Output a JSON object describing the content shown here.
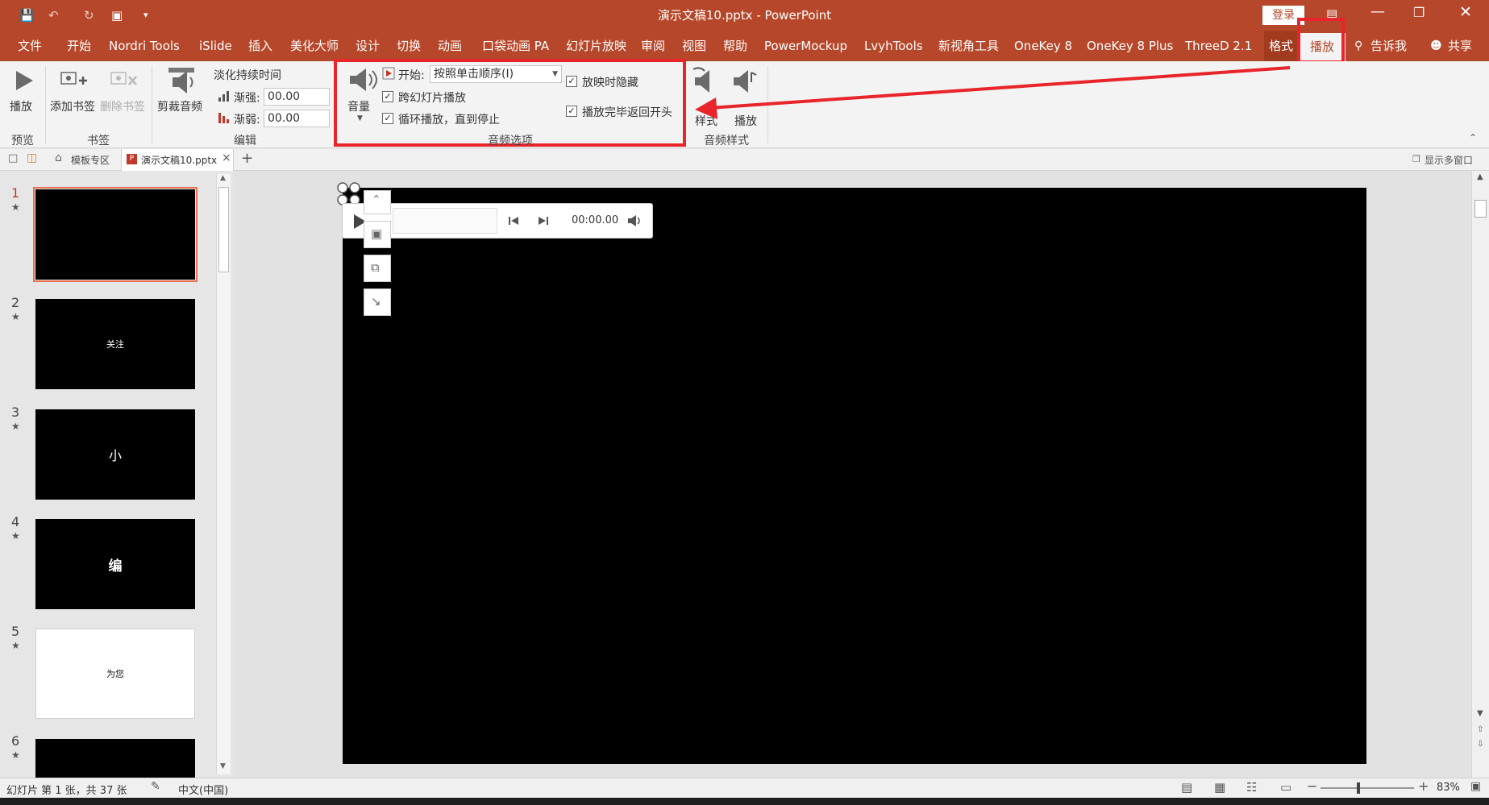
{
  "window": {
    "title": "演示文稿10.pptx  -  PowerPoint",
    "login_label": "登录"
  },
  "menu": {
    "tabs": [
      "文件",
      "开始",
      "Nordri Tools",
      "iSlide",
      "插入",
      "美化大师",
      "设计",
      "切换",
      "动画",
      "口袋动画 PA",
      "幻灯片放映",
      "审阅",
      "视图",
      "帮助",
      "PowerMockup",
      "LvyhTools",
      "新视角工具",
      "OneKey 8",
      "OneKey 8 Plus",
      "ThreeD 2.1",
      "格式",
      "播放"
    ],
    "active_tab": "播放",
    "tell_me": "告诉我",
    "share": "共享"
  },
  "ribbon": {
    "preview": {
      "play_label": "播放",
      "group": "预览"
    },
    "bookmarks": {
      "add_label": "添加书签",
      "remove_label": "删除书签",
      "group": "书签"
    },
    "editing": {
      "trim_label": "剪裁音频",
      "fade_title": "淡化持续时间",
      "fade_in_label": "渐强:",
      "fade_in_value": "00.00",
      "fade_out_label": "渐弱:",
      "fade_out_value": "00.00",
      "group": "编辑"
    },
    "audio_options": {
      "volume_label": "音量",
      "start_label": "开始:",
      "start_value": "按照单击顺序(I)",
      "across_slides": "跨幻灯片播放",
      "loop": "循环播放，直到停止",
      "hide_during_show": "放映时隐藏",
      "rewind": "播放完毕返回开头",
      "group": "音频选项"
    },
    "audio_styles": {
      "style_label": "样式",
      "play_label": "播放",
      "group": "音频样式"
    }
  },
  "doc_tabs": {
    "template": "模板专区",
    "file": "演示文稿10.pptx",
    "multi_window": "显示多窗口"
  },
  "slides": [
    {
      "num": "1",
      "text": ""
    },
    {
      "num": "2",
      "text": "关注"
    },
    {
      "num": "3",
      "text": "小"
    },
    {
      "num": "4",
      "text": "编"
    },
    {
      "num": "5",
      "text": "为您"
    },
    {
      "num": "6",
      "text": ""
    }
  ],
  "player": {
    "time": "00:00.00"
  },
  "status": {
    "slide_info": "幻灯片 第 1 张，共 37 张",
    "language": "中文(中国)",
    "zoom": "83%"
  },
  "colors": {
    "accent": "#b7472a",
    "highlight": "#e8252b"
  }
}
